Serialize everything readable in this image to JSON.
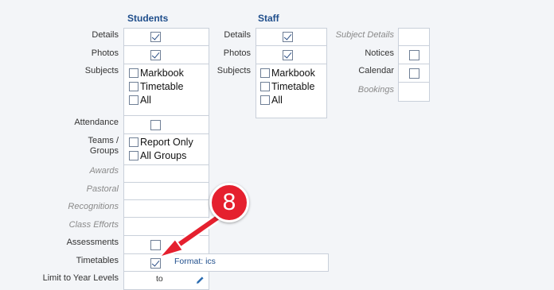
{
  "students": {
    "header": "Students",
    "details_label": "Details",
    "photos_label": "Photos",
    "subjects_label": "Subjects",
    "subjects_options": [
      "Markbook",
      "Timetable",
      "All"
    ],
    "attendance_label": "Attendance",
    "teams_label_line1": "Teams /",
    "teams_label_line2": "Groups",
    "teams_options": [
      "Report Only",
      "All Groups"
    ],
    "awards_label": "Awards",
    "pastoral_label": "Pastoral",
    "recognitions_label": "Recognitions",
    "class_efforts_label": "Class Efforts",
    "assessments_label": "Assessments",
    "timetables_label": "Timetables",
    "timetables_format": "Format: ics",
    "year_levels_label": "Limit to Year Levels",
    "year_levels_to": "to"
  },
  "staff": {
    "header": "Staff",
    "details_label": "Details",
    "photos_label": "Photos",
    "subjects_label": "Subjects",
    "subjects_options": [
      "Markbook",
      "Timetable",
      "All"
    ]
  },
  "other": {
    "subject_details_label": "Subject Details",
    "notices_label": "Notices",
    "calendar_label": "Calendar",
    "bookings_label": "Bookings"
  },
  "annotation": {
    "step_number": "8",
    "badge_color": "#e5202e"
  },
  "colors": {
    "header": "#1f4e8c",
    "checkmark": "#2b4f86",
    "cell_border": "#c9d0da"
  },
  "icons": [
    "checkmark-icon",
    "pencil-icon",
    "arrow-icon"
  ]
}
